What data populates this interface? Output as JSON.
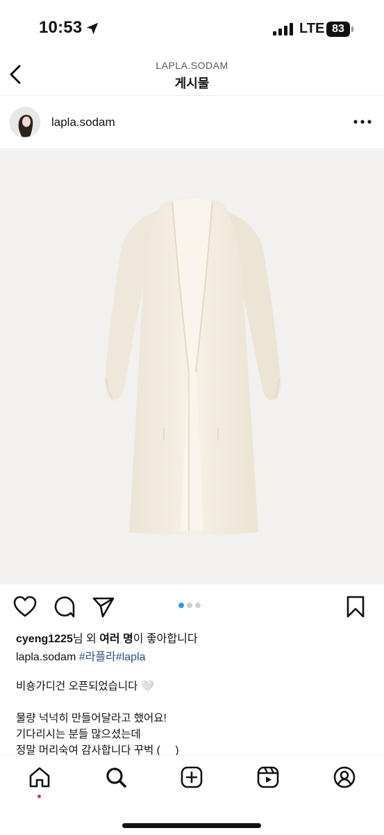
{
  "status": {
    "time": "10:53",
    "network": "LTE",
    "battery": "83"
  },
  "header": {
    "subtitle": "LAPLA.SODAM",
    "title": "게시물"
  },
  "post": {
    "username": "lapla.sodam",
    "image_count": 3,
    "active_image": 1,
    "likes": {
      "user": "cyeng1225",
      "mid": "님 외 ",
      "many": "여러 명",
      "suffix": "이 좋아합니다"
    },
    "caption": {
      "user": "lapla.sodam",
      "hashtags": "#라플라#lapla",
      "lines": [
        "비숑가디건 오픈되었습니다 🤍",
        "물량 넉넉히 만들어달라고 했어요!",
        "기다리시는 분들 많으셨는데",
        "정말 머리숙여 감사합니다 꾸벅 (_ _)"
      ]
    }
  },
  "icons": {
    "back": "chevron-left-icon",
    "more": "more-horizontal-icon",
    "like": "heart-icon",
    "comment": "comment-icon",
    "share": "paper-plane-icon",
    "save": "bookmark-icon",
    "tabs": [
      "home-icon",
      "search-icon",
      "plus-square-icon",
      "reels-icon",
      "profile-icon"
    ]
  },
  "colors": {
    "hashtag": "#2b4f82",
    "active_dot": "#3897f0",
    "notification_dot": "#e0245e"
  }
}
